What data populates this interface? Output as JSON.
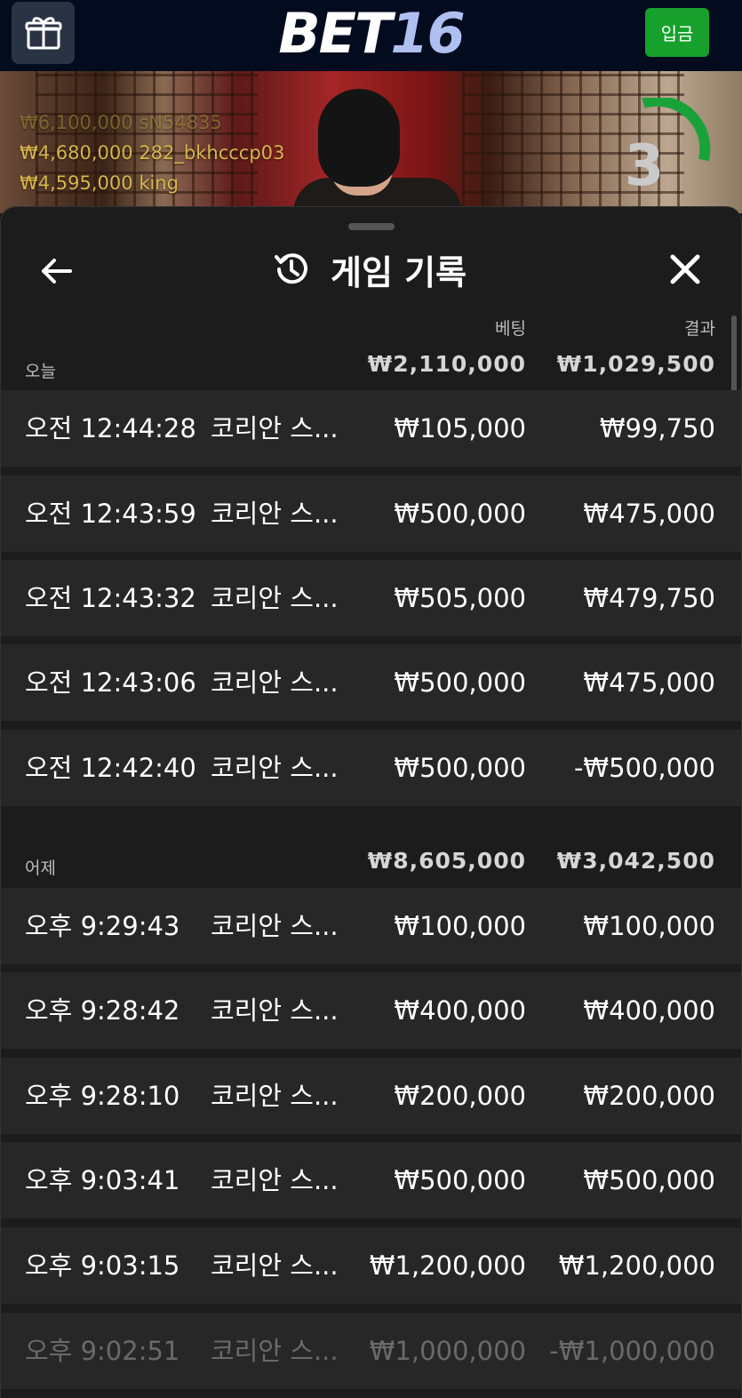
{
  "header": {
    "logo_part1": "BET",
    "logo_part2": "16",
    "deposit_label": "입금"
  },
  "video": {
    "leaderboard": [
      "₩6,100,000 sN54835",
      "₩4,680,000 282_bkhcccp03",
      "₩4,595,000 king"
    ],
    "countdown": "3"
  },
  "panel": {
    "title": "게임 기록",
    "col_bet": "베팅",
    "col_result": "결과",
    "groups": [
      {
        "label": "오늘",
        "total_bet": "₩2,110,000",
        "total_result": "₩1,029,500",
        "rows": [
          {
            "time": "오전 12:44:28",
            "game": "코리안 스...",
            "bet": "₩105,000",
            "result": "₩99,750"
          },
          {
            "time": "오전 12:43:59",
            "game": "코리안 스...",
            "bet": "₩500,000",
            "result": "₩475,000"
          },
          {
            "time": "오전 12:43:32",
            "game": "코리안 스...",
            "bet": "₩505,000",
            "result": "₩479,750"
          },
          {
            "time": "오전 12:43:06",
            "game": "코리안 스...",
            "bet": "₩500,000",
            "result": "₩475,000"
          },
          {
            "time": "오전 12:42:40",
            "game": "코리안 스...",
            "bet": "₩500,000",
            "result": "-₩500,000"
          }
        ]
      },
      {
        "label": "어제",
        "total_bet": "₩8,605,000",
        "total_result": "₩3,042,500",
        "rows": [
          {
            "time": "오후 9:29:43",
            "game": "코리안 스...",
            "bet": "₩100,000",
            "result": "₩100,000"
          },
          {
            "time": "오후 9:28:42",
            "game": "코리안 스...",
            "bet": "₩400,000",
            "result": "₩400,000"
          },
          {
            "time": "오후 9:28:10",
            "game": "코리안 스...",
            "bet": "₩200,000",
            "result": "₩200,000"
          },
          {
            "time": "오후 9:03:41",
            "game": "코리안 스...",
            "bet": "₩500,000",
            "result": "₩500,000"
          },
          {
            "time": "오후 9:03:15",
            "game": "코리안 스...",
            "bet": "₩1,200,000",
            "result": "₩1,200,000"
          },
          {
            "time": "오후 9:02:51",
            "game": "코리안 스...",
            "bet": "₩1,000,000",
            "result": "-₩1,000,000"
          }
        ]
      }
    ]
  }
}
